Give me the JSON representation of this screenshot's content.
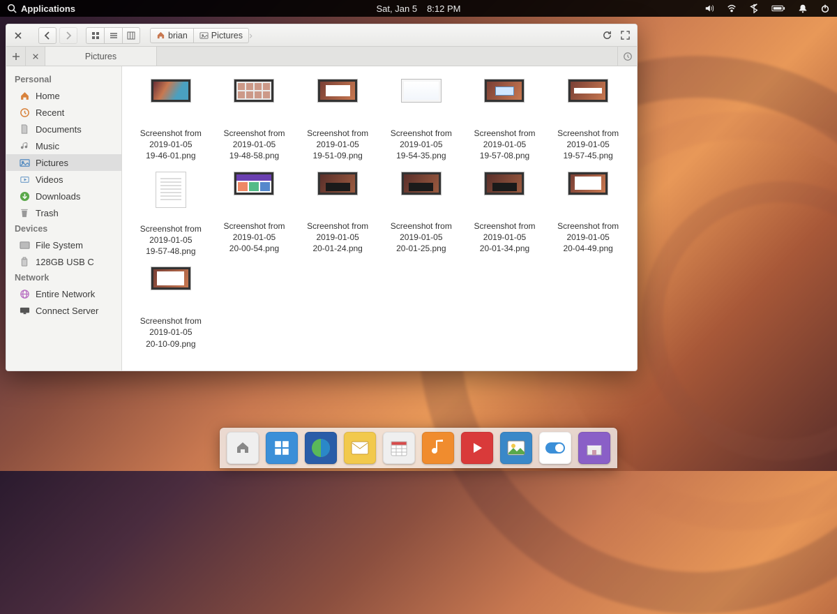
{
  "topbar": {
    "applications": "Applications",
    "date": "Sat, Jan  5",
    "time": "8:12 PM"
  },
  "window": {
    "breadcrumb": [
      "brian",
      "Pictures"
    ],
    "tab_label": "Pictures"
  },
  "sidebar": {
    "sections": [
      {
        "title": "Personal",
        "items": [
          "Home",
          "Recent",
          "Documents",
          "Music",
          "Pictures",
          "Videos",
          "Downloads",
          "Trash"
        ],
        "active_index": 4
      },
      {
        "title": "Devices",
        "items": [
          "File System",
          "128GB USB C"
        ]
      },
      {
        "title": "Network",
        "items": [
          "Entire Network",
          "Connect Server"
        ]
      }
    ]
  },
  "files": {
    "items": [
      {
        "name": "Screenshot from\n2019-01-05\n19-46-01.png",
        "thumb": "canyon"
      },
      {
        "name": "Screenshot from\n2019-01-05\n19-48-58.png",
        "thumb": "desktop"
      },
      {
        "name": "Screenshot from\n2019-01-05\n19-51-09.png",
        "thumb": "canyonwin"
      },
      {
        "name": "Screenshot from\n2019-01-05\n19-54-35.png",
        "thumb": "light"
      },
      {
        "name": "Screenshot from\n2019-01-05\n19-57-08.png",
        "thumb": "canyonblue"
      },
      {
        "name": "Screenshot from\n2019-01-05\n19-57-45.png",
        "thumb": "canyonstrip"
      },
      {
        "name": "Screenshot from\n2019-01-05\n19-57-48.png",
        "thumb": "doc"
      },
      {
        "name": "Screenshot from\n2019-01-05\n20-00-54.png",
        "thumb": "purplewin"
      },
      {
        "name": "Screenshot from\n2019-01-05\n20-01-24.png",
        "thumb": "darkwin"
      },
      {
        "name": "Screenshot from\n2019-01-05\n20-01-25.png",
        "thumb": "darkwin"
      },
      {
        "name": "Screenshot from\n2019-01-05\n20-01-34.png",
        "thumb": "darkwin"
      },
      {
        "name": "Screenshot from\n2019-01-05\n20-04-49.png",
        "thumb": "whitewin"
      },
      {
        "name": "Screenshot from\n2019-01-05\n20-10-09.png",
        "thumb": "whitewin2"
      }
    ]
  },
  "dock": {
    "items": [
      {
        "name": "files-icon",
        "bg": "#efefef",
        "glyph": "home"
      },
      {
        "name": "workspace-icon",
        "bg": "#3b8fd8",
        "glyph": "grid"
      },
      {
        "name": "browser-icon",
        "bg": "#2a5da8",
        "glyph": "globe"
      },
      {
        "name": "mail-icon",
        "bg": "#f2c94c",
        "glyph": "mail"
      },
      {
        "name": "calendar-icon",
        "bg": "#efefef",
        "glyph": "cal"
      },
      {
        "name": "music-icon",
        "bg": "#f08c2e",
        "glyph": "note"
      },
      {
        "name": "video-icon",
        "bg": "#d93a3a",
        "glyph": "play"
      },
      {
        "name": "photos-icon",
        "bg": "#3a88c8",
        "glyph": "photo"
      },
      {
        "name": "settings-icon",
        "bg": "#ffffff",
        "glyph": "toggle"
      },
      {
        "name": "appcenter-icon",
        "bg": "#8a5fc7",
        "glyph": "shop"
      }
    ]
  }
}
